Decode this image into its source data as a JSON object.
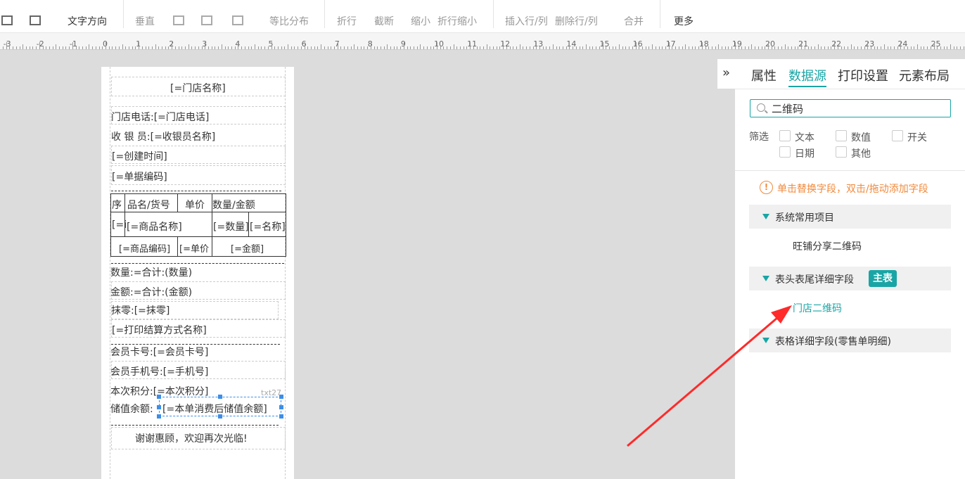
{
  "toolbar": {
    "text_direction": "文字方向",
    "vertical": "垂直",
    "equal_distribute": "等比分布",
    "wrap": "折行",
    "truncate": "截断",
    "shrink": "缩小",
    "wrap_shrink": "折行缩小",
    "insert_row_col": "插入行/列",
    "delete_row_col": "删除行/列",
    "merge": "合并",
    "more": "更多"
  },
  "ruler": {
    "labels": [
      "-3",
      "-2",
      "-1",
      "0",
      "1",
      "2",
      "3",
      "4",
      "5",
      "6",
      "7",
      "8",
      "9",
      "10",
      "11",
      "12",
      "13",
      "14",
      "15",
      "16",
      "17",
      "18",
      "19",
      "20",
      "21",
      "22",
      "23",
      "24",
      "25"
    ]
  },
  "receipt": {
    "store_name": "[=门店名称]",
    "store_phone": "门店电话:[=门店电话]",
    "cashier": "收 银 员:[=收银员名称]",
    "created_time": "[=创建时间]",
    "bill_code": "[=单据编码]",
    "th_seq": "序",
    "th_name": "品名/货号",
    "th_price": "单价",
    "th_qty_amt": "数量/金额",
    "td_seq": "[=i",
    "td_goods_name": "[=商品名称]",
    "td_qty": "[=数量]",
    "td_name": "[=名称]",
    "td_goods_code": "[=商品编码]",
    "td_unit_price": "[=单价",
    "td_amount": "[=金额]",
    "qty_total": "数量:=合计:(数量)",
    "amt_total": "金额:=合计:(金额)",
    "rounding": "抹零:[=抹零]",
    "settle_method": "[=打印结算方式名称]",
    "member_card": "会员卡号:[=会员卡号]",
    "member_phone": "会员手机号:[=手机号]",
    "points": "本次积分:[=本次积分]",
    "element_id": "txt27",
    "balance_label": "储值余额:",
    "balance_value": "[=本单消费后储值余额]",
    "thanks": "谢谢惠顾，欢迎再次光临!"
  },
  "panel": {
    "collapse_symbol": "»",
    "tabs": [
      "属性",
      "数据源",
      "打印设置",
      "元素布局"
    ],
    "active_tab": "数据源",
    "search_value": "二维码",
    "filter_label": "筛选",
    "filters": [
      "文本",
      "数值",
      "开关",
      "日期",
      "其他"
    ],
    "hint": "单击替换字段，双击/拖动添加字段",
    "groups": [
      {
        "label": "系统常用项目",
        "items": [
          "旺铺分享二维码"
        ]
      },
      {
        "label": "表头表尾详细字段",
        "badge": "主表",
        "items": [
          "门店二维码"
        ]
      },
      {
        "label": "表格详细字段(零售单明细)",
        "items": []
      }
    ]
  },
  "colors": {
    "accent": "#19a5a5",
    "hint": "#f08a3c",
    "arrow": "#ff2a2a",
    "selection": "#3d8ee8"
  }
}
